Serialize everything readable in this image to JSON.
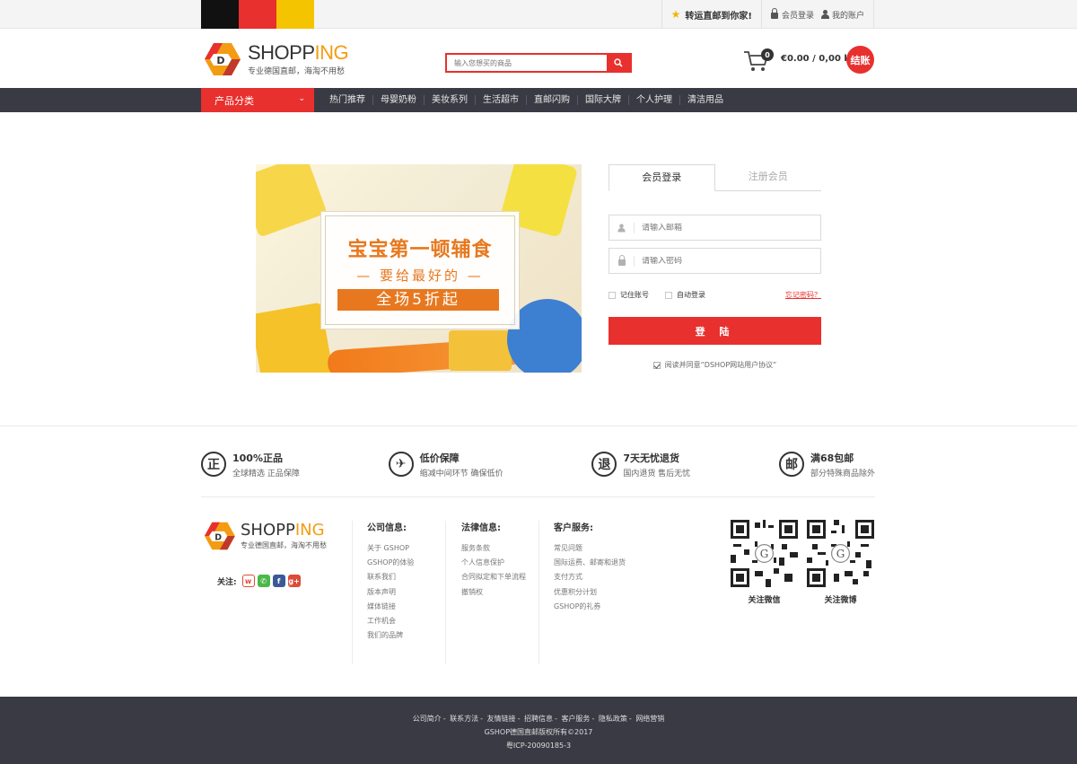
{
  "topbar": {
    "flag_colors": [
      "#111111",
      "#e8302e",
      "#f5c400"
    ],
    "promo": "转运直邮到你家!",
    "login": "会员登录",
    "account": "我的账户"
  },
  "header": {
    "logo_dark": "SHOPP",
    "logo_orange": "ING",
    "logo_letter": "D",
    "slogan": "专业德国直邮，海淘不用愁",
    "search_placeholder": "输入您想买的商品",
    "cart_count": "0",
    "cart_total": "€0.00 / 0,00 kg",
    "checkout": "结账"
  },
  "nav": {
    "category": "产品分类",
    "links": [
      "热门推荐",
      "母婴奶粉",
      "美妆系列",
      "生活超市",
      "直邮闪购",
      "国际大牌",
      "个人护理",
      "清洁用品"
    ]
  },
  "banner": {
    "line1": "宝宝第一顿辅食",
    "line2": "— 要给最好的 —",
    "line3": "全场5折起"
  },
  "login": {
    "tab_login": "会员登录",
    "tab_register": "注册会员",
    "email_placeholder": "请输入邮箱",
    "password_placeholder": "请输入密码",
    "remember": "记住账号",
    "auto": "自动登录",
    "forgot": "忘记密码？",
    "submit": "登 陆",
    "agree": "阅读并同意“DSHOP网站用户协议”"
  },
  "features": [
    {
      "icon": "正",
      "title": "100%正品",
      "sub": "全球精选 正品保障"
    },
    {
      "icon": "✈",
      "title": "低价保障",
      "sub": "缩减中间环节 确保低价"
    },
    {
      "icon": "退",
      "title": "7天无忧退货",
      "sub": "国内退货 售后无忧"
    },
    {
      "icon": "邮",
      "title": "满68包邮",
      "sub": "部分特殊商品除外"
    }
  ],
  "footer": {
    "follow": "关注:",
    "company": {
      "title": "公司信息:",
      "links": [
        "关于 GSHOP",
        "GSHOP的体验",
        "联系我们",
        "版本声明",
        "媒体链接",
        "工作机会",
        "我们的品牌"
      ]
    },
    "legal": {
      "title": "法律信息:",
      "links": [
        "服务条款",
        "个人信息保护",
        "合同拟定和下单流程",
        "撤销权"
      ]
    },
    "service": {
      "title": "客户服务:",
      "links": [
        "常见问题",
        "国际运费、邮寄和退货",
        "支付方式",
        "优惠积分计划",
        "GSHOP的礼券"
      ]
    },
    "qr_wechat": "关注微信",
    "qr_weibo": "关注微博"
  },
  "bottom": {
    "links": [
      "公司简介",
      "联系方法",
      "友情链接",
      "招聘信息",
      "客户服务",
      "隐私政策",
      "网络营销"
    ],
    "copyright": "GSHOP德国直邮版权所有©2017",
    "icp": "粤ICP-20090185-3"
  }
}
